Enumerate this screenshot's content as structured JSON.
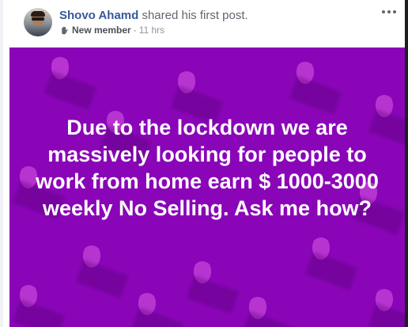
{
  "post": {
    "author_name": "Shovo Ahamd",
    "action_text": " shared his first post.",
    "badge_icon": "waving-hand-icon",
    "member_badge": "New member",
    "separator": " · ",
    "timestamp": "11 hrs",
    "more_icon": "more-options-icon",
    "body_text": "Due to the lockdown we are massively looking for people to work from home earn $ 1000-3000 weekly No Selling. Ask me how?",
    "background_color": "#8a05b8",
    "text_color": "#ffffff",
    "author_color": "#385898"
  }
}
